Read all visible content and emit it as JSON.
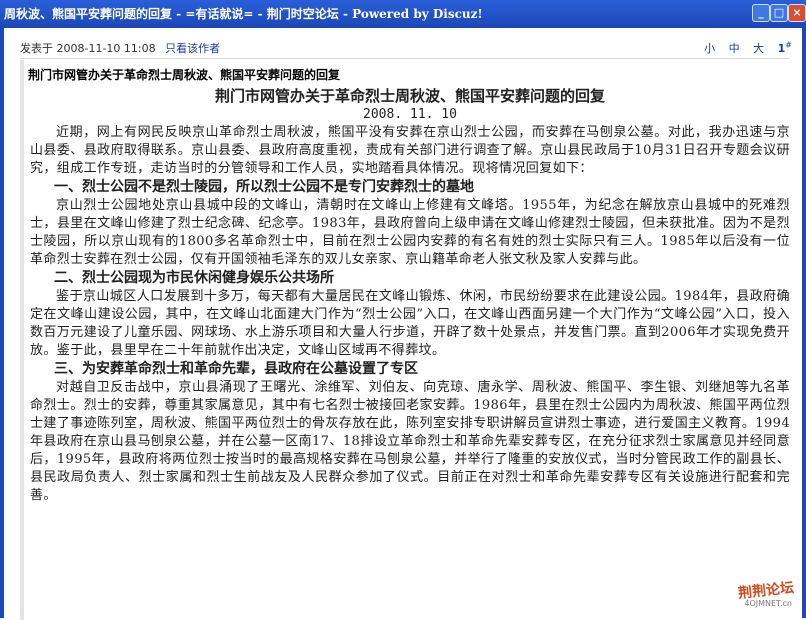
{
  "window": {
    "title": "周秋波、熊国平安葬问题的回复 - =有话就说= - 荆门时空论坛 - Powered by Discuz!",
    "buttons": [
      "_",
      "□",
      "×"
    ]
  },
  "post": {
    "posted_label": "发表于",
    "posted_time": "2008-11-10 11:08",
    "author_only_link": "只看该作者",
    "font_sizes": [
      "小",
      "中",
      "大"
    ],
    "floor": "1",
    "floor_suffix": "#",
    "subject": "荆门市网管办关于革命烈士周秋波、熊国平安葬问题的回复"
  },
  "article": {
    "title": "荆门市网管办关于革命烈士周秋波、熊国平安葬问题的回复",
    "date": "2008. 11. 10",
    "intro": "近期，网上有网民反映京山革命烈士周秋波，熊国平没有安葬在京山烈士公园，而安葬在马刨泉公墓。对此，我办迅速与京山县委、县政府取得联系。京山县委、县政府高度重视，责成有关部门进行调查了解。京山县民政局于10月31日召开专题会议研究，组成工作专班，走访当时的分管领导和工作人员，实地踏看具体情况。现将情况回复如下：",
    "section1_title": "一、烈士公园不是烈士陵园，所以烈士公园不是专门安葬烈士的墓地",
    "section1_text": "京山烈士公园地处京山县城中段的文峰山，清朝时在文峰山上修建有文峰塔。1955年，为纪念在解放京山县城中的死难烈士，县里在文峰山修建了烈士纪念碑、纪念亭。1983年，县政府曾向上级申请在文峰山修建烈士陵园，但未获批准。因为不是烈士陵园，所以京山现有的1800多名革命烈士中，目前在烈士公园内安葬的有名有姓的烈士实际只有三人。1985年以后没有一位革命烈士安葬在烈士公园，仅有开国领袖毛泽东的双儿女亲家、京山籍革命老人张文秋及家人安葬与此。",
    "section2_title": "二、烈士公园现为市民休闲健身娱乐公共场所",
    "section2_text": "鉴于京山城区人口发展到十多万，每天都有大量居民在文峰山锻炼、休闲，市民纷纷要求在此建设公园。1984年，县政府确定在文峰山建设公园，其中，在文峰山北面建大门作为“烈士公园”入口，在文峰山西面另建一个大门作为“文峰公园”入口，投入数百万元建设了儿童乐园、网球场、水上游乐项目和大量人行步道，开辟了数十处景点，并发售门票。直到2006年才实现免费开放。鉴于此，县里早在二十年前就作出决定，文峰山区域再不得葬坟。",
    "section3_title": "三、为安葬革命烈士和革命先辈，县政府在公墓设置了专区",
    "section3_text": "对越自卫反击战中，京山县涌现了王曙光、涂维军、刘伯友、向克琼、唐永学、周秋波、熊国平、李生银、刘继旭等九名革命烈士。烈士的安葬，尊重其家属意见，其中有七名烈士被接回老家安葬。1986年，县里在烈士公园内为周秋波、熊国平两位烈士建了事迹陈列室，周秋波、熊国平两位烈士的骨灰存放在此，陈列室安排专职讲解员宣讲烈士事迹，进行爱国主义教育。1994年县政府在京山县马刨泉公墓，并在公墓一区南17、18排设立革命烈士和革命先辈安葬专区，在充分征求烈士家属意见并经同意后，1995年，县政府将两位烈士按当时的最高规格安葬在马刨泉公墓，并举行了隆重的安放仪式，当时分管民政工作的副县长、县民政局负责人、烈士家属和烈士生前战友及人民群众参加了仪式。目前正在对烈士和革命先辈安葬专区有关设施进行配套和完善。"
  },
  "watermark": {
    "line1": "荆荆论坛",
    "line2": "4OJMNET.cn"
  }
}
